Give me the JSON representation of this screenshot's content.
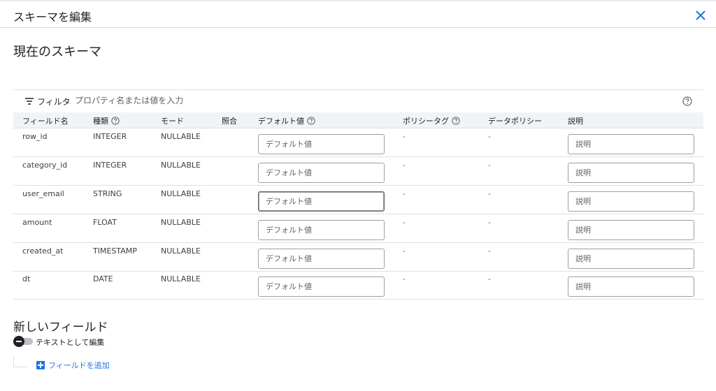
{
  "dialog": {
    "title": "スキーマを編集"
  },
  "current_schema": {
    "title": "現在のスキーマ"
  },
  "filter": {
    "label": "フィルタ",
    "placeholder": "プロパティ名または値を入力"
  },
  "columns": {
    "field_name": "フィールド名",
    "type": "種類",
    "mode": "モード",
    "collation": "照合",
    "default_value": "デフォルト値",
    "policy_tag": "ポリシータグ",
    "data_policy": "データポリシー",
    "description": "説明"
  },
  "rows": [
    {
      "name": "row_id",
      "type": "INTEGER",
      "mode": "NULLABLE",
      "collation": "",
      "default_placeholder": "デフォルト値",
      "policy_tag": "-",
      "data_policy": "-",
      "description_placeholder": "説明"
    },
    {
      "name": "category_id",
      "type": "INTEGER",
      "mode": "NULLABLE",
      "collation": "",
      "default_placeholder": "デフォルト値",
      "policy_tag": "-",
      "data_policy": "-",
      "description_placeholder": "説明"
    },
    {
      "name": "user_email",
      "type": "STRING",
      "mode": "NULLABLE",
      "collation": "",
      "default_placeholder": "デフォルト値",
      "policy_tag": "-",
      "data_policy": "-",
      "description_placeholder": "説明"
    },
    {
      "name": "amount",
      "type": "FLOAT",
      "mode": "NULLABLE",
      "collation": "",
      "default_placeholder": "デフォルト値",
      "policy_tag": "-",
      "data_policy": "-",
      "description_placeholder": "説明"
    },
    {
      "name": "created_at",
      "type": "TIMESTAMP",
      "mode": "NULLABLE",
      "collation": "",
      "default_placeholder": "デフォルト値",
      "policy_tag": "-",
      "data_policy": "-",
      "description_placeholder": "説明"
    },
    {
      "name": "dt",
      "type": "DATE",
      "mode": "NULLABLE",
      "collation": "",
      "default_placeholder": "デフォルト値",
      "policy_tag": "-",
      "data_policy": "-",
      "description_placeholder": "説明"
    }
  ],
  "new_fields": {
    "title": "新しいフィールド",
    "edit_as_text_label": "テキストとして編集",
    "edit_as_text_enabled": false,
    "add_field_label": "フィールドを追加"
  },
  "icons": {
    "close": "close-icon",
    "filter": "filter-icon",
    "help": "help-icon",
    "add": "add-box-icon"
  },
  "colors": {
    "accent": "#1a73e8",
    "header_bg": "#f1f3f4",
    "border": "#e0e0e0"
  }
}
